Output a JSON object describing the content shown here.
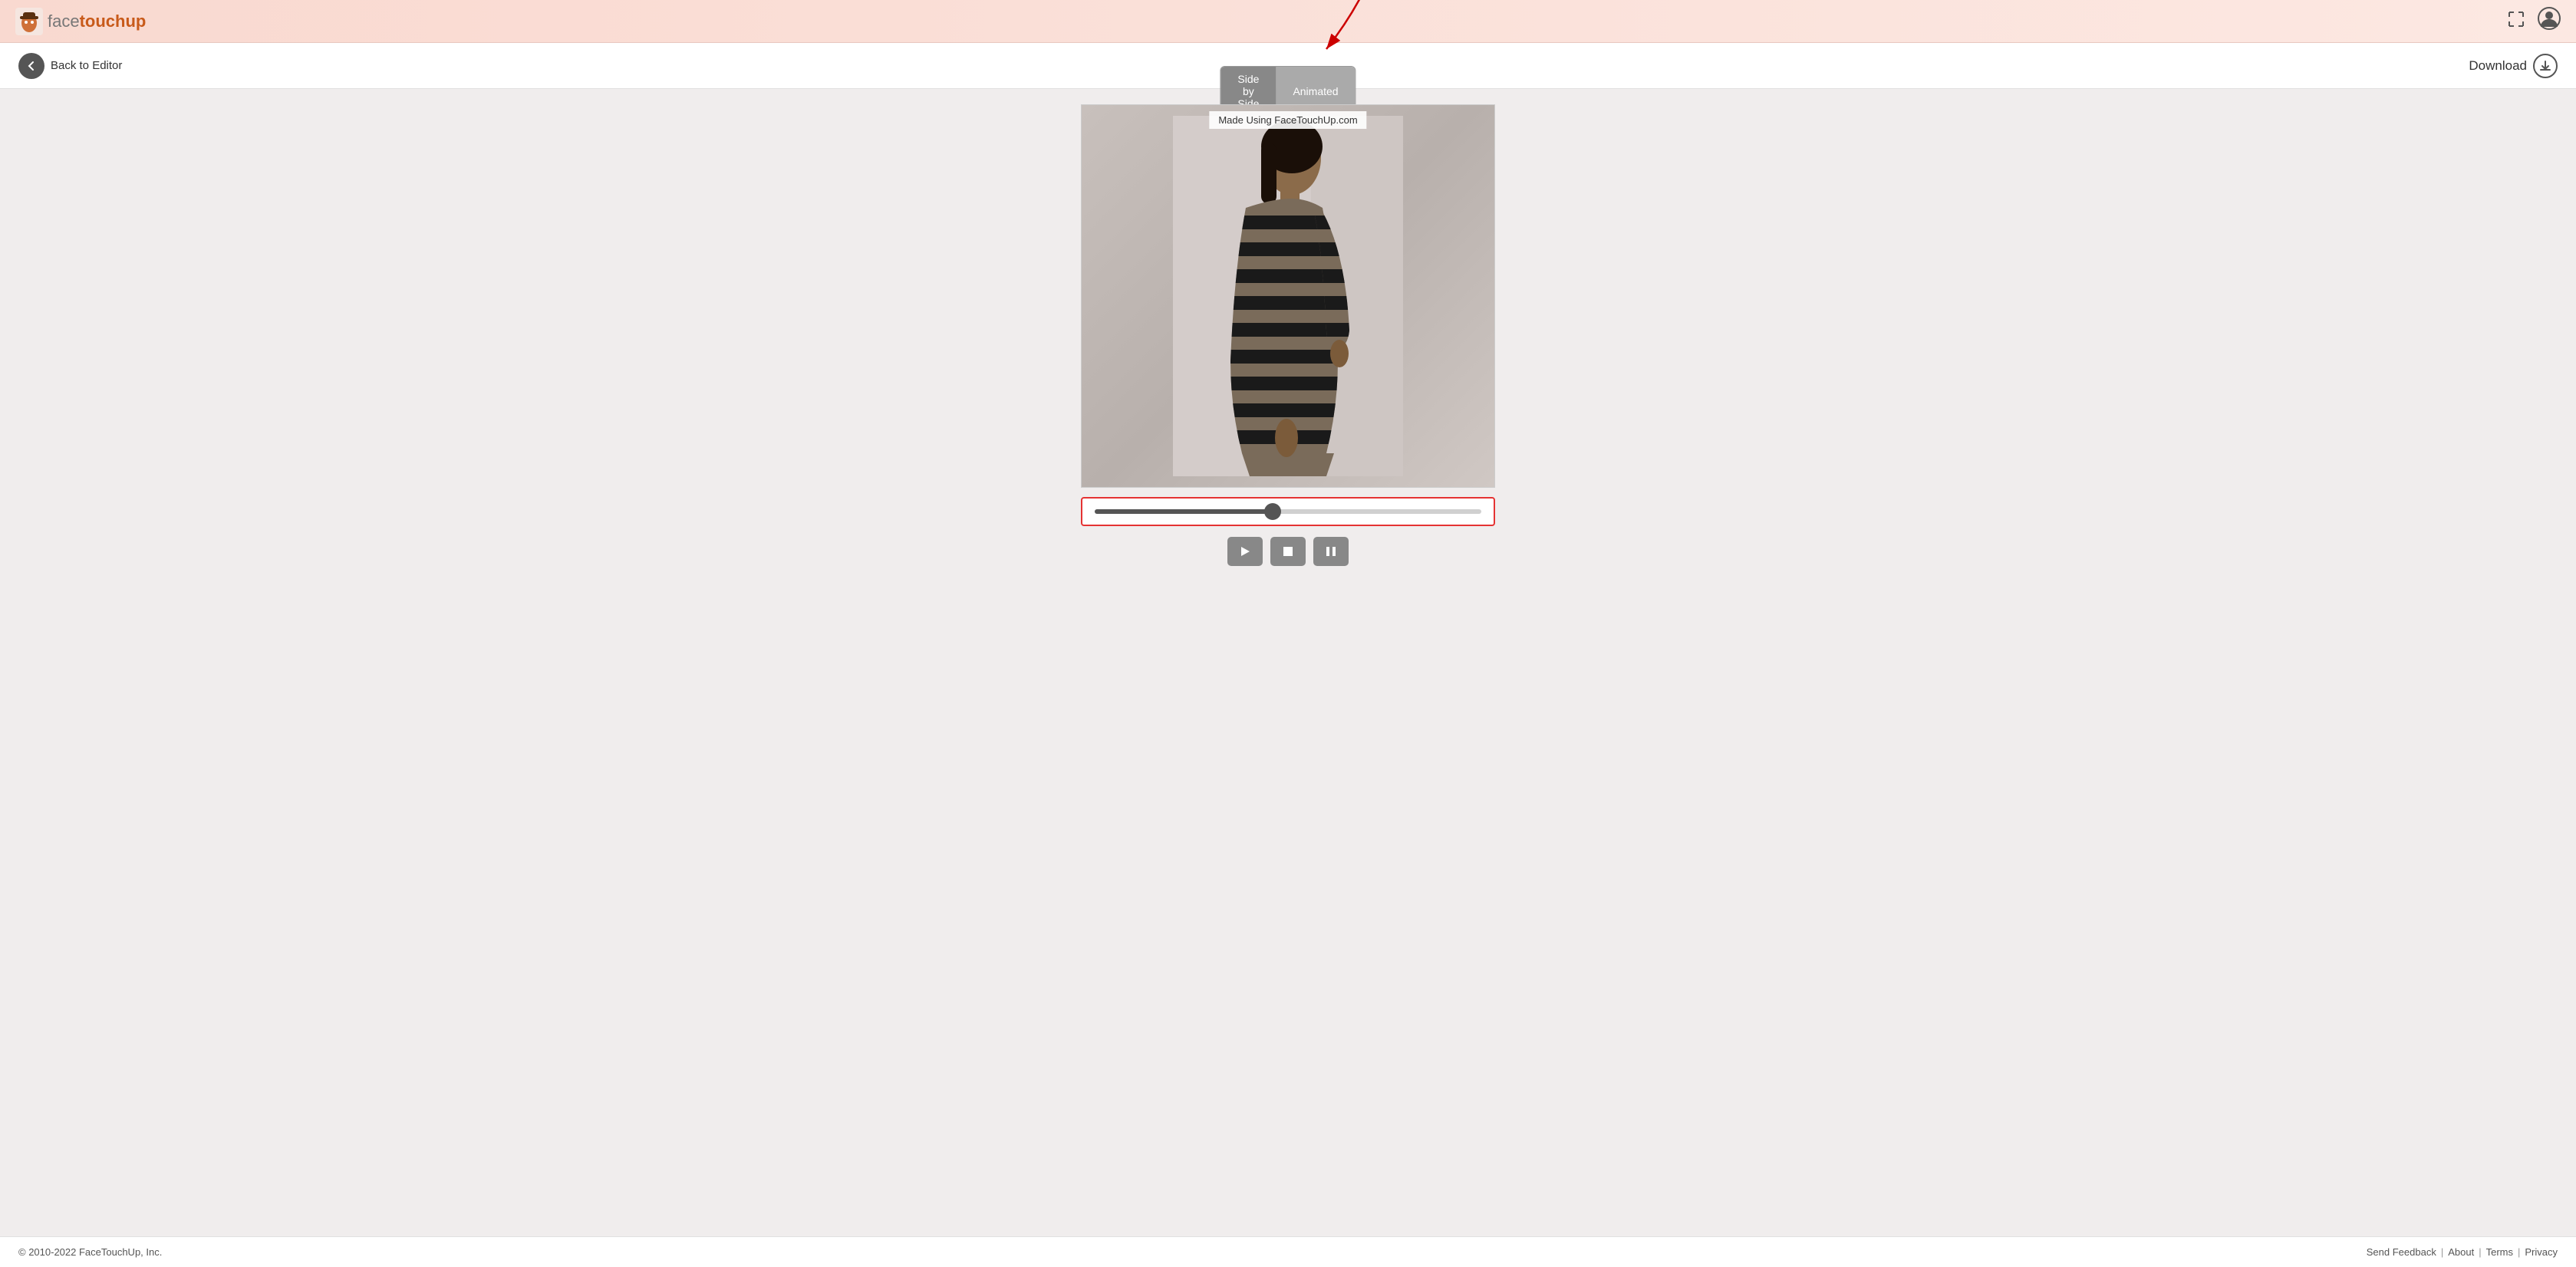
{
  "logo": {
    "face_text": "face",
    "touchup_text": "touchup",
    "alt": "FaceTouchUp Logo"
  },
  "nav": {
    "fullscreen_title": "Fullscreen",
    "user_title": "User Account"
  },
  "sub_header": {
    "back_label": "Back to Editor",
    "view_toggle": {
      "side_by_side": "Side by Side",
      "animated": "Animated"
    },
    "download_label": "Download"
  },
  "main": {
    "watermark": "Made Using FaceTouchUp.com",
    "slider": {
      "progress": 46
    }
  },
  "footer": {
    "copyright": "© 2010-2022 FaceTouchUp, Inc.",
    "links": [
      {
        "label": "Send Feedback",
        "id": "send-feedback"
      },
      {
        "label": "About",
        "id": "about"
      },
      {
        "label": "Terms",
        "id": "terms"
      },
      {
        "label": "Privacy",
        "id": "privacy"
      }
    ]
  }
}
